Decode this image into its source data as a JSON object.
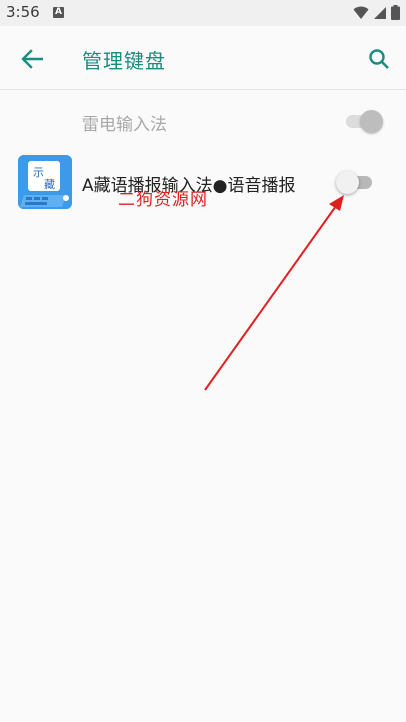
{
  "status_bar": {
    "time": "3:56",
    "notification_badge": "A",
    "icons": [
      "wifi-icon",
      "signal-icon",
      "battery-icon"
    ]
  },
  "app_bar": {
    "title": "管理键盘",
    "back_icon": "arrow-back-icon",
    "search_icon": "search-icon"
  },
  "keyboards": [
    {
      "label": "雷电输入法",
      "enabled": true,
      "disabled_state": true
    },
    {
      "label": "A藏语播报输入法●语音播报",
      "enabled": false,
      "disabled_state": false,
      "icon_text": [
        "示",
        "藏"
      ]
    }
  ],
  "watermark": "二狗资源网",
  "colors": {
    "accent": "#1a8e7e",
    "annotation_red": "#e02020",
    "app_icon_blue": "#3d9ae8"
  }
}
